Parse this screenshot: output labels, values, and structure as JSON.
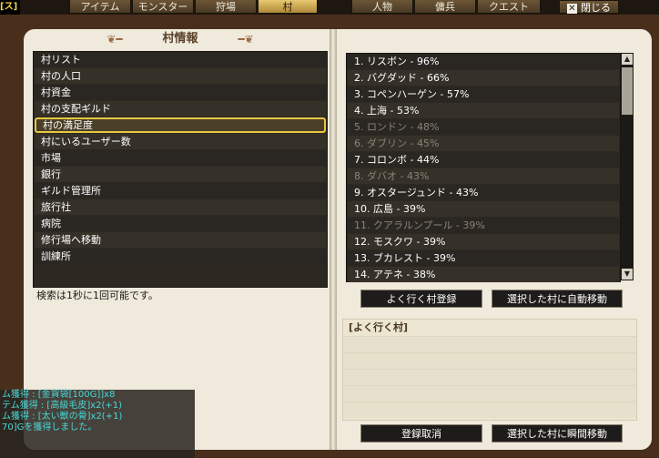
{
  "tabs": {
    "corner_mark": "[ス]",
    "items": [
      {
        "label": "アイテム",
        "active": false
      },
      {
        "label": "モンスター",
        "active": false
      },
      {
        "label": "狩場",
        "active": false
      },
      {
        "label": "村",
        "active": true
      },
      {
        "label": "人物",
        "active": false
      },
      {
        "label": "傭兵",
        "active": false
      },
      {
        "label": "クエスト",
        "active": false
      }
    ],
    "close_label": "閉じる"
  },
  "left_page": {
    "title": "村情報",
    "menu": [
      "村リスト",
      "村の人口",
      "村資金",
      "村の支配ギルド",
      "村の満足度",
      "村にいるユーザー数",
      "市場",
      "銀行",
      "ギルド管理所",
      "旅行社",
      "病院",
      "修行場へ移動",
      "訓練所"
    ],
    "selected_index": 4,
    "note": "検索は1秒に1回可能です。"
  },
  "right_page": {
    "villages": [
      {
        "text": "1. リスボン - 96%",
        "dim": false
      },
      {
        "text": "2. バグダッド - 66%",
        "dim": false
      },
      {
        "text": "3. コペンハーゲン - 57%",
        "dim": false
      },
      {
        "text": "4. 上海 - 53%",
        "dim": false
      },
      {
        "text": "5. ロンドン - 48%",
        "dim": true
      },
      {
        "text": "6. ダブリン - 45%",
        "dim": true
      },
      {
        "text": "7. コロンボ - 44%",
        "dim": false
      },
      {
        "text": "8. ダバオ - 43%",
        "dim": true
      },
      {
        "text": "9. オスタージュンド - 43%",
        "dim": false
      },
      {
        "text": "10. 広島 - 39%",
        "dim": false
      },
      {
        "text": "11. クアラルンプール - 39%",
        "dim": true
      },
      {
        "text": "12. モスクワ - 39%",
        "dim": false
      },
      {
        "text": "13. ブカレスト - 39%",
        "dim": false
      },
      {
        "text": "14. アテネ - 38%",
        "dim": false
      }
    ],
    "register_button": "よく行く村登録",
    "auto_move_button": "選択した村に自動移動",
    "favorites_header": "[よく行く村]",
    "unregister_button": "登録取消",
    "instant_move_button": "選択した村に瞬間移動"
  },
  "chat_log": [
    "ム獲得 : [金貨袋[100G]]x8",
    "テム獲得 : [高級毛皮]x2(+1)",
    "ム獲得 : [太い獣の骨]x2(+1)",
    "70]Gを獲得しました。"
  ]
}
